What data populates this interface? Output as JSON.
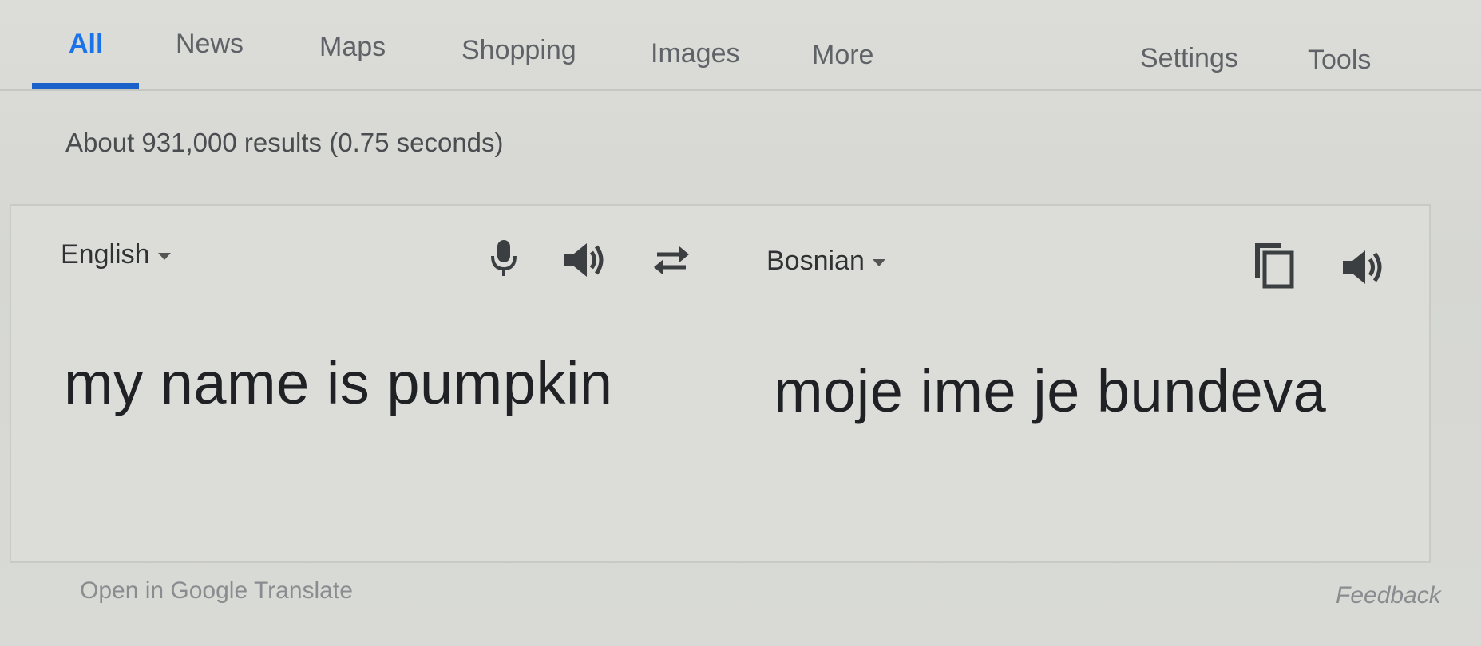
{
  "tabs": [
    {
      "label": "All",
      "active": true
    },
    {
      "label": "News"
    },
    {
      "label": "Maps"
    },
    {
      "label": "Shopping"
    },
    {
      "label": "Images"
    },
    {
      "label": "More"
    }
  ],
  "right_tabs": {
    "settings": "Settings",
    "tools": "Tools"
  },
  "result_stats": "About 931,000 results (0.75 seconds)",
  "translate": {
    "source_language": "English",
    "target_language": "Bosnian",
    "source_text": "my name is pumpkin",
    "translated_text": "moje ime je bundeva",
    "icons": {
      "microphone": "microphone-icon",
      "listen_source": "speaker-icon",
      "swap": "swap-languages-icon",
      "copy": "copy-icon",
      "listen_target": "speaker-icon"
    }
  },
  "footer": {
    "open_link": "Open in Google Translate",
    "feedback": "Feedback"
  },
  "colors": {
    "accent": "#1a73e8",
    "background": "#d9dad6"
  }
}
